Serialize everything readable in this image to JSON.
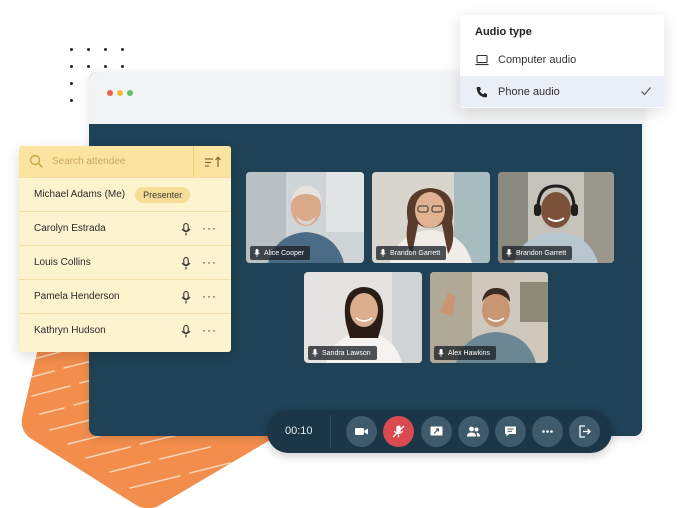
{
  "audio_menu": {
    "title": "Audio type",
    "options": [
      {
        "label": "Computer audio",
        "icon": "laptop-icon",
        "selected": false
      },
      {
        "label": "Phone audio",
        "icon": "phone-icon",
        "selected": true
      }
    ]
  },
  "attendees_panel": {
    "search_placeholder": "Search attendee",
    "sort_icon": "sort-icon",
    "attendees": [
      {
        "name": "Michael Adams (Me)",
        "badge": "Presenter"
      },
      {
        "name": "Carolyn Estrada"
      },
      {
        "name": "Louis Collins"
      },
      {
        "name": "Pamela Henderson"
      },
      {
        "name": "Kathryn Hudson"
      }
    ]
  },
  "video_tiles": [
    {
      "name": "Alice Cooper"
    },
    {
      "name": "Brandon Garrett"
    },
    {
      "name": "Brandon Garrett"
    },
    {
      "name": "Sandra Lawson"
    },
    {
      "name": "Alex Hawkins"
    }
  ],
  "controls": {
    "timer": "00:10",
    "buttons": [
      "video-camera-icon",
      "mic-muted-icon",
      "screen-share-icon",
      "participants-icon",
      "chat-icon",
      "more-options-icon",
      "leave-icon"
    ]
  },
  "colors": {
    "stage": "#1f4256",
    "panel": "#fdf3cf",
    "panel_header": "#fbe4a0",
    "control_bar": "#1b3646",
    "mute_red": "#d94a51",
    "accent_orange": "#f28d4c"
  }
}
